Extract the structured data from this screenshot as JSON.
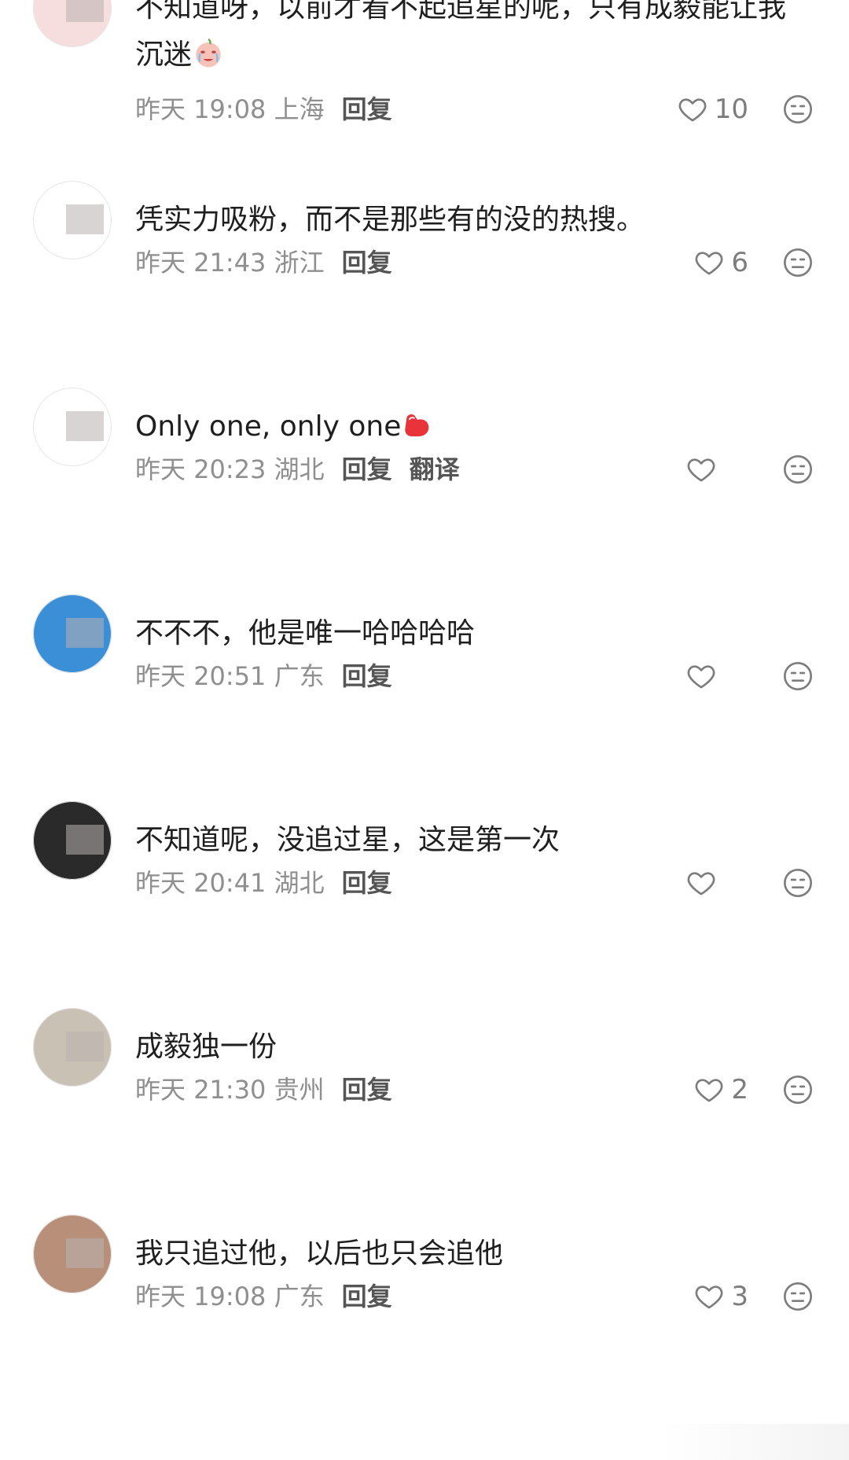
{
  "comments": [
    {
      "username": "",
      "content": "不知道呀，以前才看不起追星的呢，只有成毅能让我沉迷",
      "date": "昨天",
      "time": "19:08",
      "location": "上海",
      "reply_label": "回复",
      "likes": "10",
      "avatar_color": "#f6dede",
      "emoji": "crying-face"
    },
    {
      "username": "",
      "content": "凭实力吸粉，而不是那些有的没的热搜。",
      "date": "昨天",
      "time": "21:43",
      "location": "浙江",
      "reply_label": "回复",
      "likes": "6",
      "avatar_color": "#ffffff"
    },
    {
      "username": "",
      "content": "Only one, only one",
      "date": "昨天",
      "time": "20:23",
      "location": "湖北",
      "reply_label": "回复",
      "translate_label": "翻译",
      "likes": "",
      "avatar_color": "#ffffff",
      "emoji": "flexed-biceps"
    },
    {
      "username": "",
      "content": "不不不，他是唯一哈哈哈哈",
      "date": "昨天",
      "time": "20:51",
      "location": "广东",
      "reply_label": "回复",
      "likes": "",
      "avatar_color": "#3a8fd6"
    },
    {
      "username": "",
      "content": "不知道呢，没追过星，这是第一次",
      "date": "昨天",
      "time": "20:41",
      "location": "湖北",
      "reply_label": "回复",
      "likes": "",
      "avatar_color": "#2a2a2a"
    },
    {
      "username": "",
      "content": "成毅独一份",
      "date": "昨天",
      "time": "21:30",
      "location": "贵州",
      "reply_label": "回复",
      "likes": "2",
      "avatar_color": "#c9c2b4"
    },
    {
      "username": "",
      "content": "我只追过他，以后也只会追他",
      "date": "昨天",
      "time": "19:08",
      "location": "广东",
      "reply_label": "回复",
      "likes": "3",
      "avatar_color": "#b8907a"
    }
  ],
  "colors": {
    "text_primary": "#1f1f1f",
    "text_meta": "#8f8f8f",
    "icon": "#7d7d7d"
  }
}
